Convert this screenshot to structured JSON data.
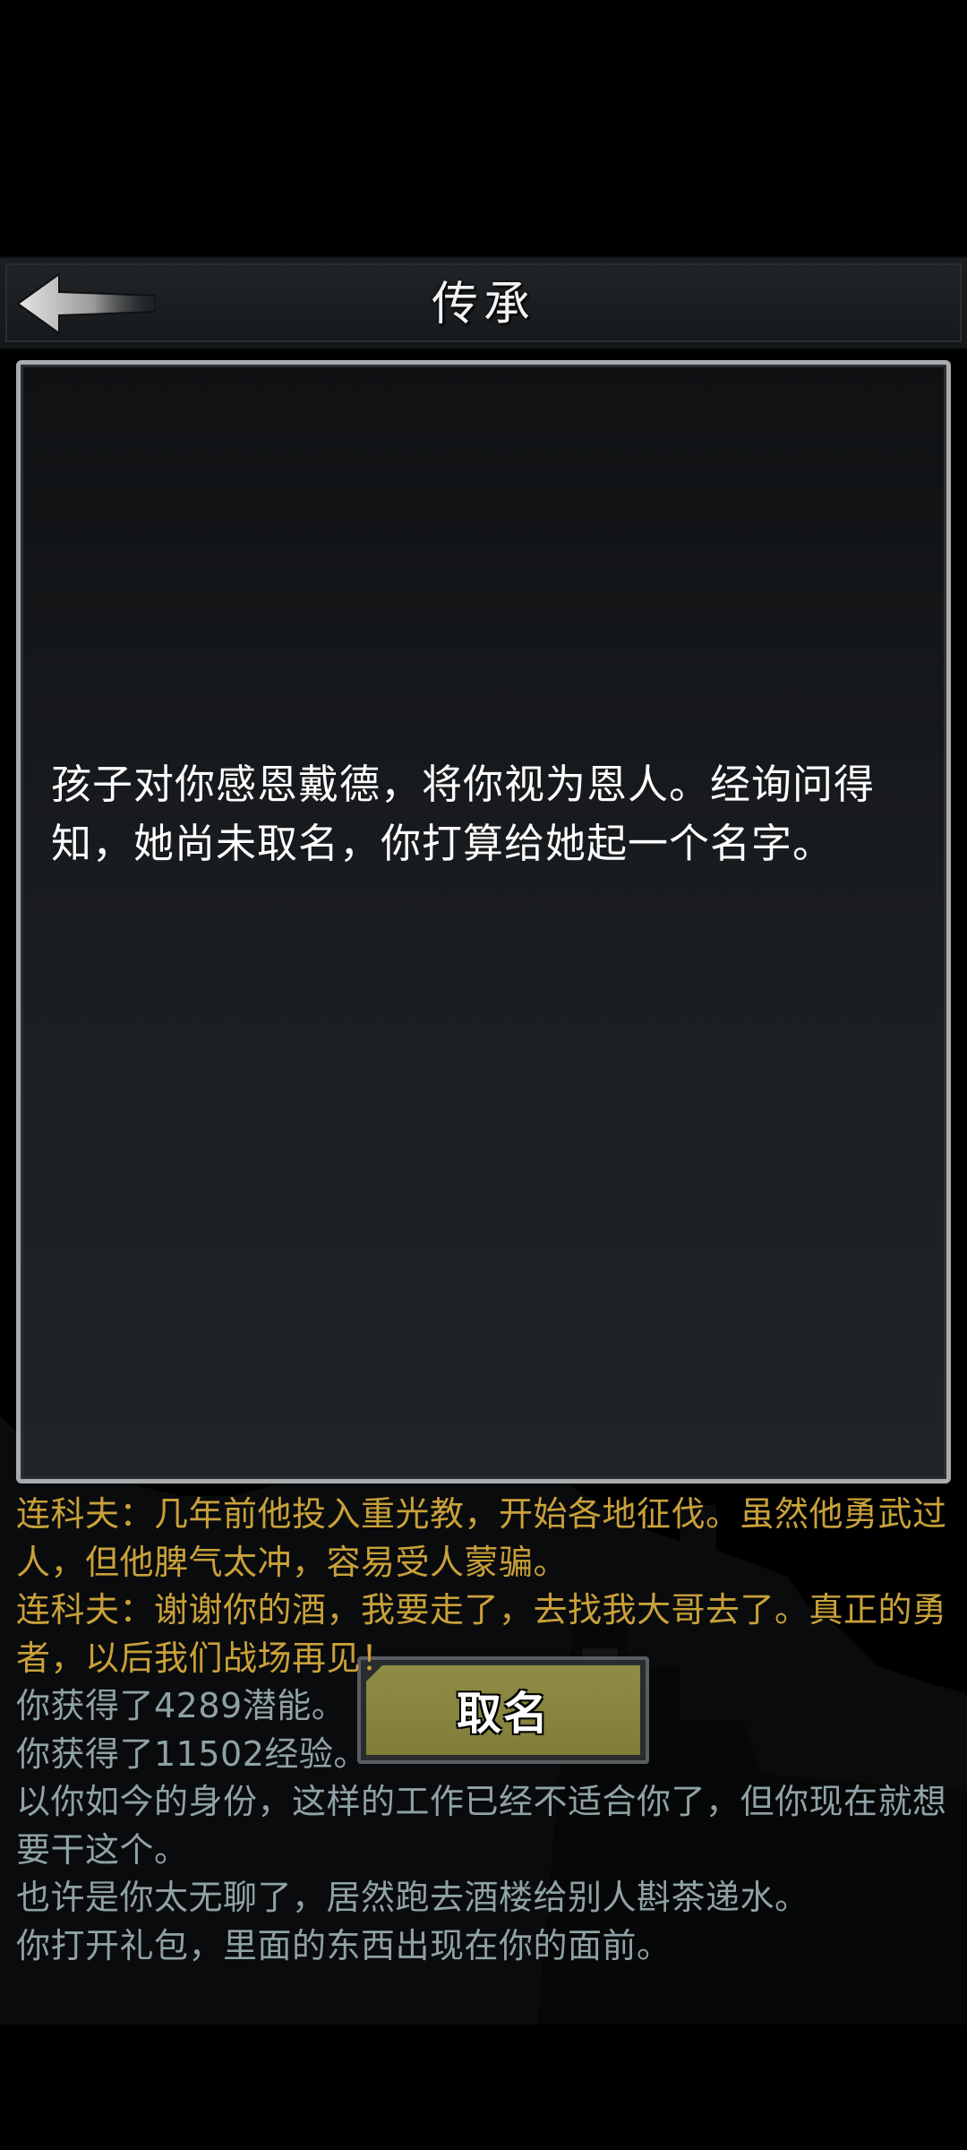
{
  "header": {
    "title": "传承"
  },
  "dialog": {
    "text": "孩子对你感恩戴德，将你视为恩人。经询问得知，她尚未取名，你打算给她起一个名字。",
    "button_label": "取名"
  },
  "log": [
    {
      "text": "连科夫：几年前他投入重光教，开始各地征伐。虽然他勇武过人，但他脾气太冲，容易受人蒙骗。",
      "kind": "npc"
    },
    {
      "text": "连科夫：谢谢你的酒，我要走了，去找我大哥去了。真正的勇者，以后我们战场再见！",
      "kind": "npc"
    },
    {
      "text": "你获得了4289潜能。",
      "kind": "sys"
    },
    {
      "text": "你获得了11502经验。",
      "kind": "sys"
    },
    {
      "text": "以你如今的身份，这样的工作已经不适合你了，但你现在就想要干这个。",
      "kind": "sys"
    },
    {
      "text": "也许是你太无聊了，居然跑去酒楼给别人斟茶递水。",
      "kind": "sys"
    },
    {
      "text": "你打开礼包，里面的东西出现在你的面前。",
      "kind": "sys"
    }
  ],
  "colors": {
    "npc_text": "#c9a13a",
    "system_text": "#8fa2a6",
    "button_face": "#8f8d45"
  },
  "icons": {
    "back": "arrow-left-icon"
  }
}
